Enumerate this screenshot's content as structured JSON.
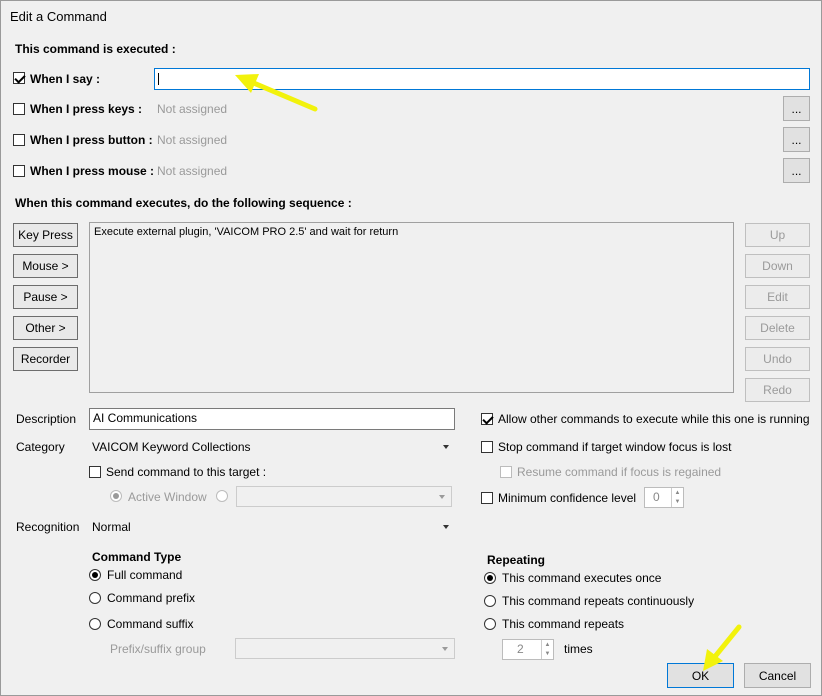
{
  "window": {
    "title": "Edit a Command"
  },
  "trigger": {
    "heading": "This command is executed :",
    "say": {
      "label": "When I say :",
      "checked": true,
      "value": ""
    },
    "keys": {
      "label": "When I press keys :",
      "checked": false,
      "value": "Not assigned",
      "btn": "..."
    },
    "button": {
      "label": "When I press button :",
      "checked": false,
      "value": "Not assigned",
      "btn": "..."
    },
    "mouse": {
      "label": "When I press mouse :",
      "checked": false,
      "value": "Not assigned",
      "btn": "..."
    }
  },
  "sequence": {
    "heading": "When this command executes, do the following sequence :",
    "left_buttons": [
      "Key Press",
      "Mouse >",
      "Pause >",
      "Other >",
      "Recorder"
    ],
    "right_buttons": [
      "Up",
      "Down",
      "Edit",
      "Delete",
      "Undo",
      "Redo"
    ],
    "items": [
      "Execute external plugin, 'VAICOM PRO 2.5' and wait for return"
    ]
  },
  "details": {
    "description_label": "Description",
    "description_value": "AI Communications",
    "category_label": "Category",
    "category_value": "VAICOM Keyword Collections",
    "send_target_label": "Send command to this target :",
    "active_window_label": "Active Window",
    "recognition_label": "Recognition",
    "recognition_value": "Normal"
  },
  "options": {
    "allow_other": "Allow other commands to execute while this one is running",
    "stop_focus": "Stop command if target window focus is lost",
    "resume_focus": "Resume command if focus is regained",
    "min_conf": "Minimum confidence level",
    "min_conf_value": "0"
  },
  "command_type": {
    "heading": "Command Type",
    "options": [
      "Full command",
      "Command prefix",
      "Command suffix"
    ],
    "prefix_group_label": "Prefix/suffix group"
  },
  "repeating": {
    "heading": "Repeating",
    "options": [
      "This command executes once",
      "This command repeats continuously",
      "This command repeats"
    ],
    "times_value": "2",
    "times_label": "times"
  },
  "footer": {
    "ok": "OK",
    "cancel": "Cancel"
  },
  "annotation_color": "#f2f20c"
}
